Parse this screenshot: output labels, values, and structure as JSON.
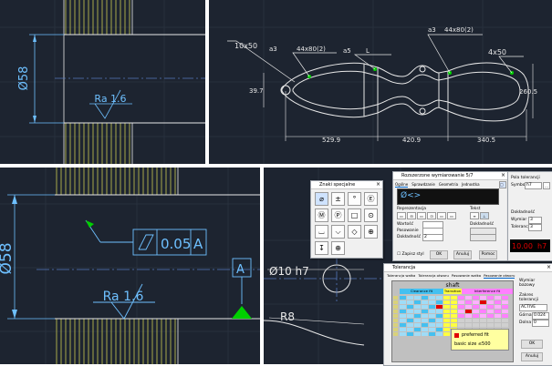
{
  "panel_tl": {
    "diameter": "Ø58",
    "roughness": "Ra 1.6"
  },
  "panel_tr": {
    "chamfer_left": "10x50",
    "weld_left": "a3",
    "weld_left_len": "44x80(2)",
    "weld_mid": "a5",
    "weld_mid_tail": "L",
    "weld_right": "a3",
    "weld_right_len": "44x80(2)",
    "chamfer_right": "4x50",
    "dim_height_left": "39.7",
    "dim_height_right": "260.5",
    "dim_bottom_1": "529.9",
    "dim_bottom_2": "420.9",
    "dim_bottom_3": "340.5"
  },
  "panel_bl": {
    "diameter": "Ø58",
    "tolerance_value": "0.05",
    "datum": "A",
    "datum_box": "A",
    "roughness": "Ra 1.6"
  },
  "panel_br": {
    "hole_dim": "Ø10 h7",
    "radius": "R8"
  },
  "symbols_dialog": {
    "title": "Znaki specjalne",
    "symbols": [
      "⌀",
      "±",
      "°",
      "Ⓔ",
      "Ⓜ",
      "Ⓟ",
      "□",
      "⊙",
      "⌴",
      "⌵",
      "◇",
      "⊕",
      "↧",
      "⊕"
    ]
  },
  "dim_dialog": {
    "title": "Rozszerzone wymiarowanie 5/7",
    "tabs": [
      "Ogólne",
      "Sprawdzanie",
      "Geometria",
      "Jednostka"
    ],
    "edit_text": "Ø<>",
    "group_repr": "Reprezentacja",
    "group_text": "Tekst",
    "lbl_value": "Wartość",
    "lbl_fit": "Pasowanie",
    "lbl_precision": "Dokładność",
    "lbl_tolerance": "Dokładność",
    "lbl_dim": "Wymiar",
    "lbl_tol": "Tolerancja",
    "precision_val": "2",
    "fit_label": "Pola tolerancji",
    "fit_symbol_label": "Symbol",
    "fit_symbol": "h7",
    "dim_precision": "3",
    "tol_precision": "3",
    "checkbox": "Zapisz styl",
    "ok": "OK",
    "apply": "Anuluj",
    "help": "Pomoc",
    "preview_value": "10.00",
    "preview_fit": "h7"
  },
  "tol_dialog": {
    "title": "Tolerancja",
    "tabs": [
      "Tolerancja wałka",
      "Tolerancja otworu",
      "Pasowanie wałka",
      "Pasowanie otworu"
    ],
    "header": "shaft",
    "band_labels": [
      "Clearance fit",
      "Transition",
      "Interference fit"
    ],
    "legend_text": "preferred fit",
    "legend_basic": "basic size ≤500",
    "side_labels": [
      "Wymiar bazowy",
      "Zakres tolerancji",
      "Górna",
      "Dolna"
    ],
    "side_values": [
      "",
      "ACTIVE",
      "0.024",
      "0"
    ],
    "ok": "OK",
    "cancel": "Anuluj"
  },
  "colors": {
    "cad_bg": "#1d2430",
    "cad_line": "#ffffff",
    "cad_text": "#6ec0ff",
    "green": "#00d000",
    "red_led": "#e00000"
  }
}
